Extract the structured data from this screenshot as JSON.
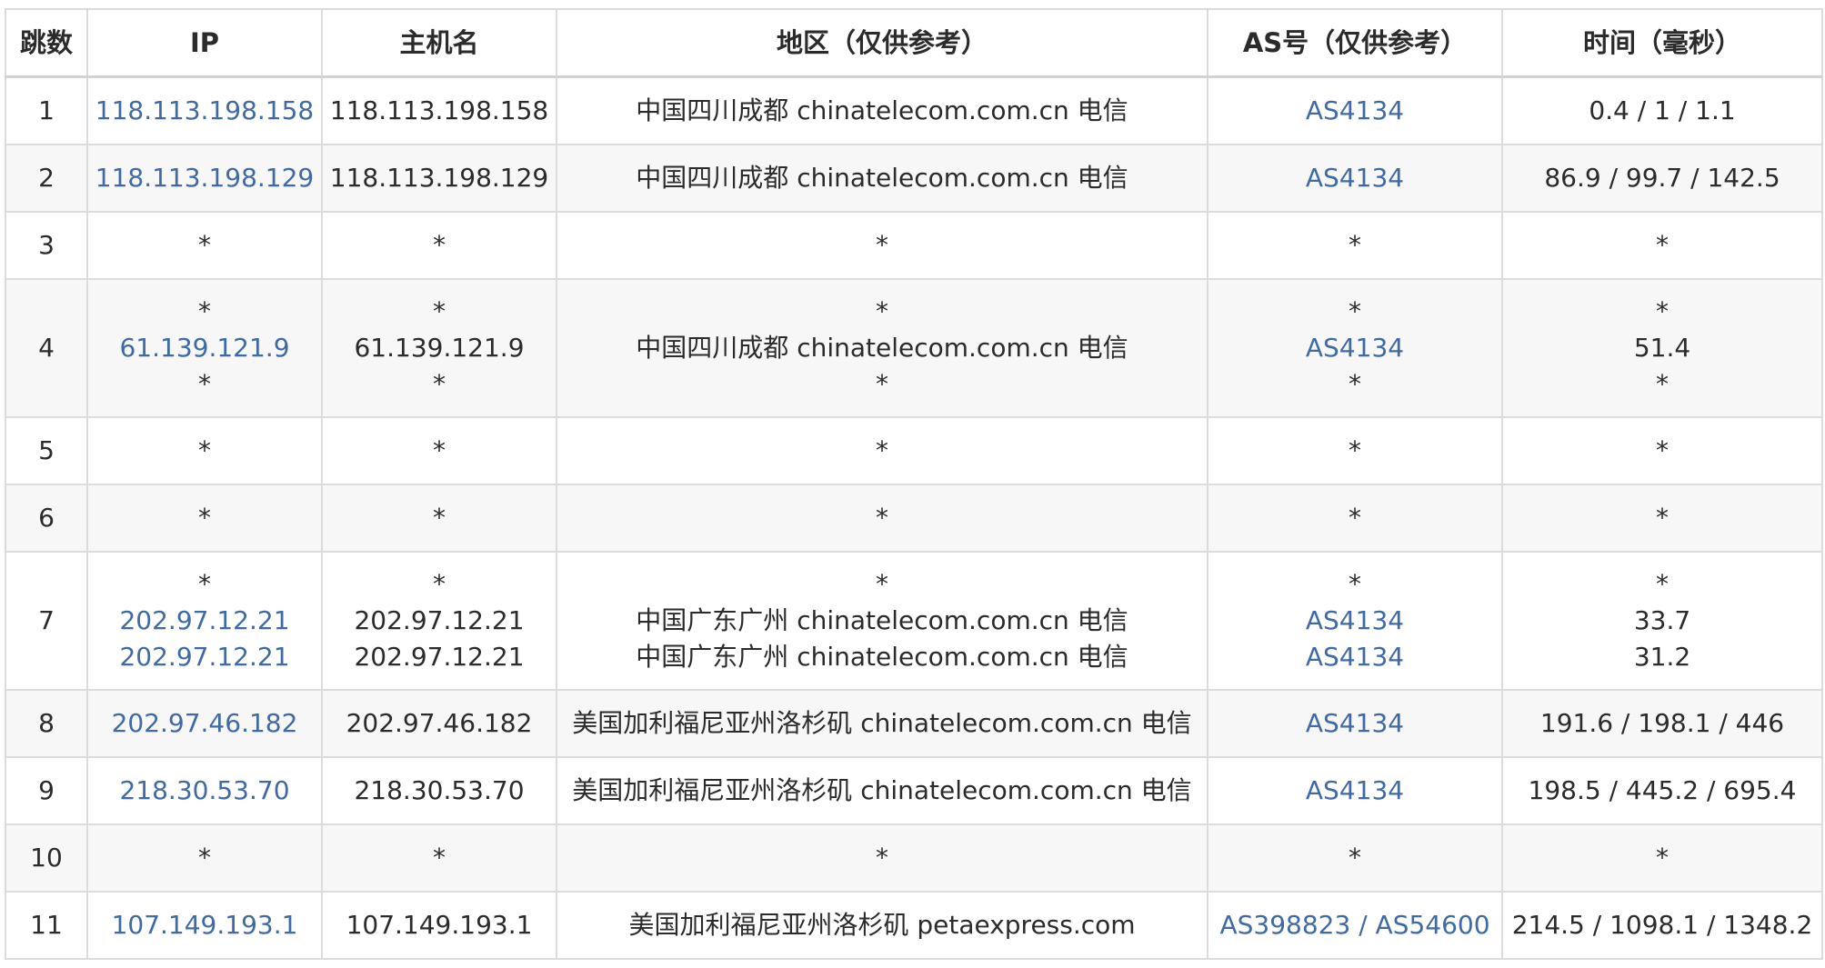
{
  "headers": {
    "hop": "跳数",
    "ip": "IP",
    "host": "主机名",
    "region": "地区（仅供参考）",
    "as": "AS号（仅供参考）",
    "time": "时间（毫秒）"
  },
  "colors": {
    "link": "#3e6aa6",
    "shade": "#f7f7f7",
    "border": "#dcdcdc"
  },
  "rows": [
    {
      "hop": "1",
      "ip": "118.113.198.158",
      "host": "118.113.198.158",
      "region": "中国四川成都 chinatelecom.com.cn 电信",
      "as": "AS4134",
      "time": "0.4 / 1 / 1.1"
    },
    {
      "hop": "2",
      "ip": "118.113.198.129",
      "host": "118.113.198.129",
      "region": "中国四川成都 chinatelecom.com.cn 电信",
      "as": "AS4134",
      "time": "86.9 / 99.7 / 142.5"
    },
    {
      "hop": "3",
      "ip": "*",
      "host": "*",
      "region": "*",
      "as": "*",
      "time": "*"
    },
    {
      "hop": "4",
      "ip": [
        "*",
        "61.139.121.9",
        "*"
      ],
      "host": [
        "*",
        "61.139.121.9",
        "*"
      ],
      "region": [
        "*",
        "中国四川成都 chinatelecom.com.cn 电信",
        "*"
      ],
      "as": [
        "*",
        "AS4134",
        "*"
      ],
      "time": [
        "*",
        "51.4",
        "*"
      ]
    },
    {
      "hop": "5",
      "ip": "*",
      "host": "*",
      "region": "*",
      "as": "*",
      "time": "*"
    },
    {
      "hop": "6",
      "ip": "*",
      "host": "*",
      "region": "*",
      "as": "*",
      "time": "*"
    },
    {
      "hop": "7",
      "ip": [
        "*",
        "202.97.12.21",
        "202.97.12.21"
      ],
      "host": [
        "*",
        "202.97.12.21",
        "202.97.12.21"
      ],
      "region": [
        "*",
        "中国广东广州 chinatelecom.com.cn 电信",
        "中国广东广州 chinatelecom.com.cn 电信"
      ],
      "as": [
        "*",
        "AS4134",
        "AS4134"
      ],
      "time": [
        "*",
        "33.7",
        "31.2"
      ]
    },
    {
      "hop": "8",
      "ip": "202.97.46.182",
      "host": "202.97.46.182",
      "region": "美国加利福尼亚州洛杉矶 chinatelecom.com.cn 电信",
      "as": "AS4134",
      "time": "191.6 / 198.1 / 446"
    },
    {
      "hop": "9",
      "ip": "218.30.53.70",
      "host": "218.30.53.70",
      "region": "美国加利福尼亚州洛杉矶 chinatelecom.com.cn 电信",
      "as": "AS4134",
      "time": "198.5 / 445.2 / 695.4"
    },
    {
      "hop": "10",
      "ip": "*",
      "host": "*",
      "region": "*",
      "as": "*",
      "time": "*"
    },
    {
      "hop": "11",
      "ip": "107.149.193.1",
      "host": "107.149.193.1",
      "region": "美国加利福尼亚州洛杉矶 petaexpress.com",
      "as": [
        "AS398823",
        "AS54600"
      ],
      "as_separator": " / ",
      "time": "214.5 / 1098.1 / 1348.2"
    }
  ]
}
